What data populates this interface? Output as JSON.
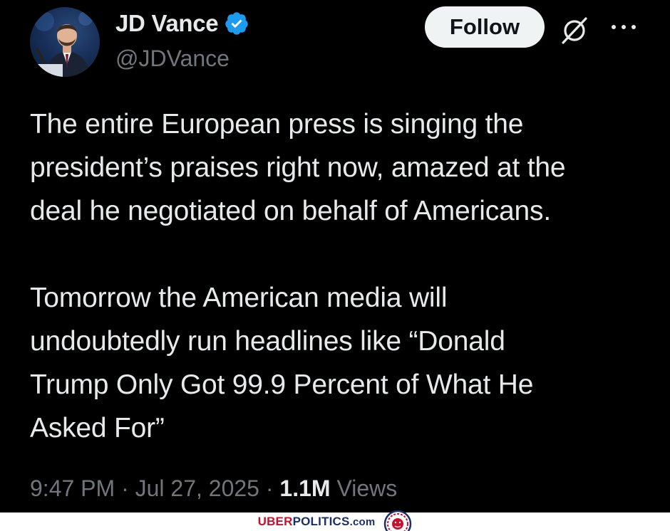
{
  "author": {
    "display_name": "JD Vance",
    "handle": "@JDVance",
    "verified": true,
    "avatar_icon": "profile-photo"
  },
  "actions": {
    "follow_label": "Follow",
    "grok_icon": "grok-slash-circle-icon",
    "more_icon": "more-horizontal-icon"
  },
  "tweet": {
    "paragraphs": [
      "The entire European press is singing the\npresident’s praises right now, amazed at the\ndeal he negotiated on behalf of Americans.",
      "Tomorrow the American media will\nundoubtedly run headlines like “Donald\nTrump Only Got 99.9 Percent of What He\nAsked For”"
    ]
  },
  "meta": {
    "time": "9:47 PM",
    "separator": "·",
    "date": "Jul 27, 2025",
    "views_count": "1.1M",
    "views_label": "Views"
  },
  "watermark": {
    "part1": "UBER",
    "part2": "POLITICS",
    "part3": ".com",
    "logo_icon": "lion-crest-icon"
  },
  "colors": {
    "background": "#000000",
    "text_primary": "#e7e9ea",
    "text_secondary": "#71767b",
    "verified_blue": "#1d9bf0",
    "follow_bg": "#eff3f4",
    "brand_red": "#c8102e",
    "brand_navy": "#1a2f6b"
  }
}
